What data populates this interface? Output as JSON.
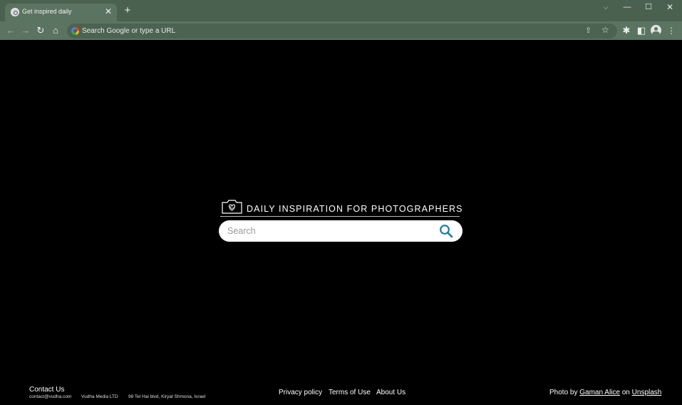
{
  "browser": {
    "tab": {
      "title": "Get inspired daily",
      "close_glyph": "✕"
    },
    "new_tab_glyph": "+",
    "window_controls": {
      "tab_search_glyph": "⌵",
      "minimize_glyph": "—",
      "maximize_glyph": "☐",
      "close_glyph": "✕"
    },
    "toolbar": {
      "back_glyph": "←",
      "forward_glyph": "→",
      "reload_glyph": "↻",
      "home_glyph": "⌂",
      "address_placeholder": "Search Google or type a URL",
      "share_glyph": "⇪",
      "bookmark_glyph": "☆",
      "extensions_glyph": "✱",
      "side_panel_glyph": "◧",
      "menu_glyph": "⋮"
    }
  },
  "page": {
    "brand": {
      "text": "DAILY INSPIRATION FOR PHOTOGRAPHERS",
      "logo_icon": "camera-heart-icon"
    },
    "search": {
      "placeholder": "Search",
      "icon": "magnifier-icon",
      "accent_color": "#1c7aa3"
    },
    "footer": {
      "contact_title": "Contact Us",
      "email": "contact@vudha.com",
      "company": "Vudha Media LTD",
      "address": "98 Tel Hai blvd, Kiryat Shmona, Israel",
      "links": [
        "Privacy policy",
        "Terms of Use",
        "About Us"
      ],
      "credit": {
        "prefix": "Photo by",
        "author": "Gaman Alice",
        "middle": "on",
        "source": "Unsplash"
      }
    }
  },
  "colors": {
    "tabstrip": "#4b6150",
    "toolbar": "#5b7461",
    "page_background": "#000000"
  }
}
